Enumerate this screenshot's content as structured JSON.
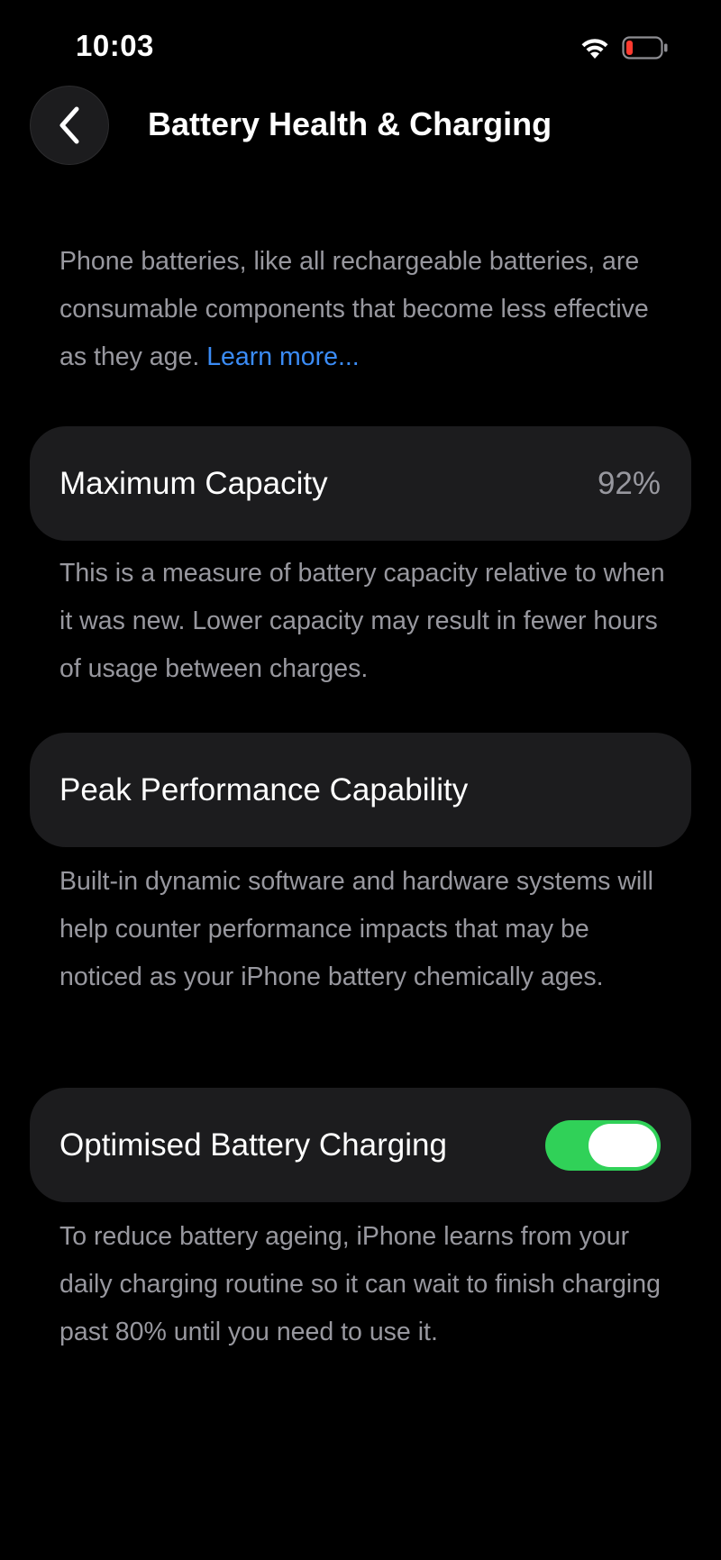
{
  "status_bar": {
    "time": "10:03",
    "wifi_icon": "wifi-icon",
    "battery_icon": "battery-low-icon",
    "battery_color": "#ff3b30"
  },
  "nav": {
    "back_icon": "chevron-left-icon",
    "title": "Battery Health & Charging"
  },
  "intro": {
    "text": "Phone batteries, like all rechargeable batteries, are consumable components that become less effective as they age. ",
    "link": "Learn more..."
  },
  "maximum_capacity": {
    "label": "Maximum Capacity",
    "value": "92%",
    "description": "This is a measure of battery capacity relative to when it was new. Lower capacity may result in fewer hours of usage between charges."
  },
  "peak_performance": {
    "label": "Peak Performance Capability",
    "description": "Built-in dynamic software and hardware systems will help counter performance impacts that may be noticed as your iPhone battery chemically ages."
  },
  "optimised_charging": {
    "label": "Optimised Battery Charging",
    "enabled": true,
    "toggle_color": "#30d158",
    "description": "To reduce battery ageing, iPhone learns from your daily charging routine so it can wait to finish charging past 80% until you need to use it."
  },
  "colors": {
    "background": "#000000",
    "card": "#1c1c1e",
    "secondary_text": "#98989f",
    "link": "#3b8cf6"
  }
}
